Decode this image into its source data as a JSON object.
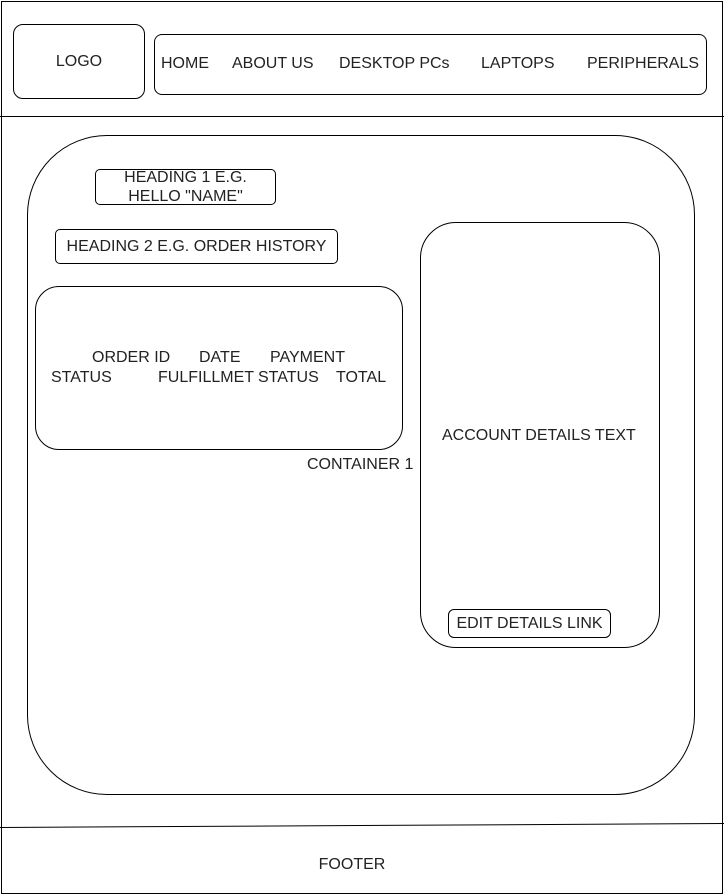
{
  "header": {
    "logo": "LOGO",
    "nav": [
      {
        "label": "HOME"
      },
      {
        "label": "ABOUT US"
      },
      {
        "label": "DESKTOP PCs"
      },
      {
        "label": "LAPTOPS"
      },
      {
        "label": "PERIPHERALS"
      }
    ]
  },
  "main": {
    "heading1_line1": "HEADING 1 E.G.",
    "heading1_line2": "HELLO \"NAME\"",
    "heading2": "HEADING 2 E.G. ORDER HISTORY",
    "order_table": {
      "header_row1": [
        "ORDER ID",
        "DATE",
        "PAYMENT"
      ],
      "header_row2": [
        "STATUS",
        "FULFILLMET",
        "STATUS",
        "TOTAL"
      ]
    },
    "container_label": "CONTAINER 1",
    "account": {
      "text": "ACCOUNT DETAILS TEXT",
      "edit_link": "EDIT DETAILS LINK"
    }
  },
  "footer": {
    "label": "FOOTER"
  }
}
